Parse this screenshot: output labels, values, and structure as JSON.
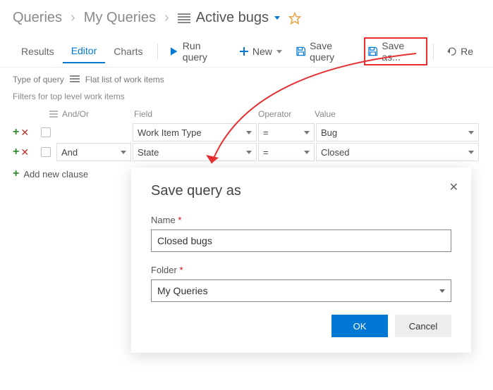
{
  "breadcrumb": {
    "root": "Queries",
    "mid": "My Queries",
    "current": "Active bugs"
  },
  "tabs": {
    "results": "Results",
    "editor": "Editor",
    "charts": "Charts"
  },
  "toolbar": {
    "run": "Run query",
    "new": "New",
    "save": "Save query",
    "saveas": "Save as...",
    "re": "Re"
  },
  "meta": {
    "typeofquery": "Type of query",
    "flatlist": "Flat list of work items"
  },
  "filters": {
    "label": "Filters for top level work items",
    "headers": {
      "andor": "And/Or",
      "field": "Field",
      "operator": "Operator",
      "value": "Value"
    },
    "rows": [
      {
        "andor": "",
        "field": "Work Item Type",
        "op": "=",
        "value": "Bug"
      },
      {
        "andor": "And",
        "field": "State",
        "op": "=",
        "value": "Closed"
      }
    ],
    "addclause": "Add new clause"
  },
  "dialog": {
    "title": "Save query as",
    "name_label": "Name",
    "name_value": "Closed bugs",
    "folder_label": "Folder",
    "folder_value": "My Queries",
    "ok": "OK",
    "cancel": "Cancel"
  }
}
